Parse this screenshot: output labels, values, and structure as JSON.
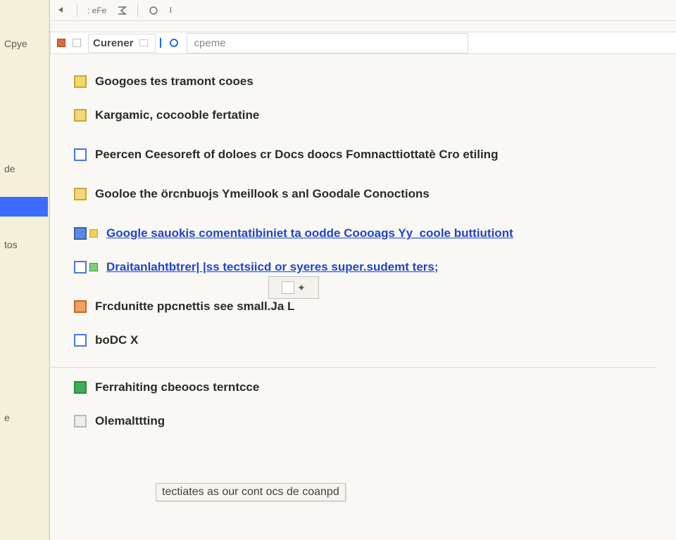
{
  "leftcol": {
    "top_label": "Cpye",
    "section_de": "de",
    "section_tos": "tos",
    "section_e": "e"
  },
  "toolbar": {
    "txt1": ": eFe",
    "cursor_hint": "I"
  },
  "bar2": {
    "chip_label": "Curener",
    "search_placeholder": "cpeme"
  },
  "items": [
    {
      "icon": "yellow",
      "label": "Googoes tes tramont cooes"
    },
    {
      "icon": "yellow2",
      "label": "Kargamic, cocooble fertatine"
    },
    {
      "icon": "blue-outline",
      "label": "Peercen Ceesoreft of doloes cr Docs doocs Fomnacttiottatè Cro etiling"
    },
    {
      "icon": "yellow2",
      "label": "Gooloe the örcnbuojs Ymeillook s anl Goodale Conoctions"
    },
    {
      "icon": "blue-fill",
      "link": true,
      "label": "Google sauokis comentatibiniet ta oodde Coooags Yy_coole buttiutiont"
    },
    {
      "icon": "blue-outline",
      "link": true,
      "label": "Draitanlahtbtrer|          |ss tectsiicd or syeres super.sudemt ters;"
    },
    {
      "icon": "orange",
      "label": "Frcdunitte ppcnettis see small.Ja L"
    },
    {
      "icon": "blue-outline",
      "label": "boDC  X"
    }
  ],
  "section2": [
    {
      "icon": "green",
      "label": "Ferrahiting cbeoocs terntcce"
    },
    {
      "icon": "grey",
      "label": "Olemalttting"
    }
  ],
  "tooltip": "tectiates as our cont ocs de coanpd",
  "cursor_box_glyph": "✦"
}
